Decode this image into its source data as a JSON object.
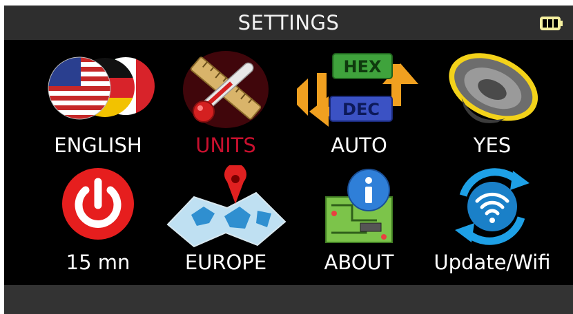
{
  "header": {
    "title": "SETTINGS",
    "battery_icon": "battery-full-icon"
  },
  "tiles": [
    {
      "label": "ENGLISH",
      "icon": "language-flags-icon",
      "selected": false
    },
    {
      "label": "UNITS",
      "icon": "units-ruler-thermometer-icon",
      "selected": true
    },
    {
      "label": "AUTO",
      "icon": "hex-dec-switch-icon",
      "selected": false
    },
    {
      "label": "YES",
      "icon": "speaker-icon",
      "selected": false
    },
    {
      "label": "15 mn",
      "icon": "power-icon",
      "selected": false
    },
    {
      "label": "EUROPE",
      "icon": "map-pin-icon",
      "selected": false
    },
    {
      "label": "ABOUT",
      "icon": "info-circuit-icon",
      "selected": false
    },
    {
      "label": "Update/Wifi",
      "icon": "wifi-update-icon",
      "selected": false
    }
  ],
  "colors": {
    "selected_label": "#c8102e",
    "header_bg": "#2e2e2e",
    "footer_bg": "#333333",
    "screen_bg": "#000000"
  }
}
